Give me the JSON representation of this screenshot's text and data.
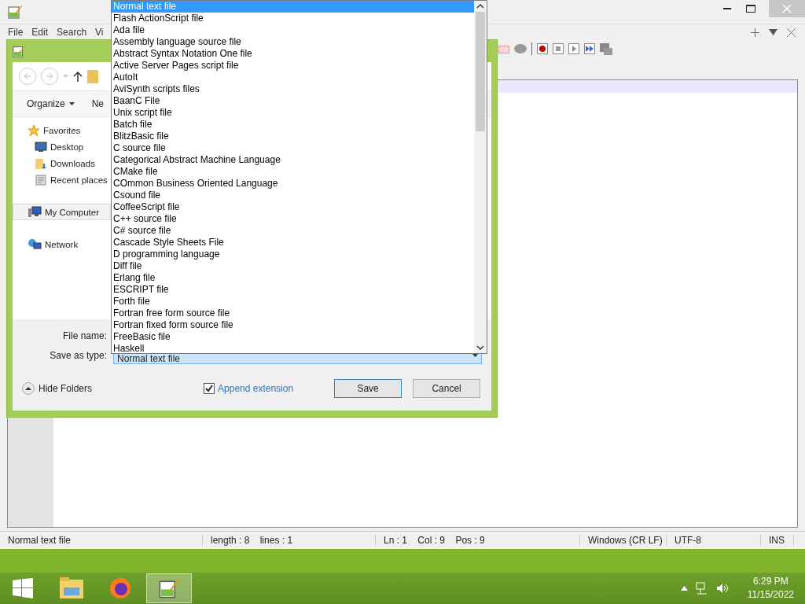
{
  "app_window": {
    "menu": [
      "File",
      "Edit",
      "Search",
      "Vi"
    ]
  },
  "status_bar": [
    "Normal text file",
    "length : 8    lines : 1",
    "Ln : 1    Col : 9    Pos : 9",
    "Windows (CR LF)",
    "UTF-8",
    "INS"
  ],
  "dialog": {
    "toolbar": [
      "Organize",
      "Ne"
    ],
    "sidebar": [
      {
        "label": "Favorites",
        "kind": "star",
        "selected": false,
        "children": [
          {
            "label": "Desktop",
            "kind": "desktop",
            "selected": false
          },
          {
            "label": "Downloads",
            "kind": "downloads",
            "selected": false
          },
          {
            "label": "Recent places",
            "kind": "recent",
            "selected": false
          }
        ]
      },
      {
        "label": "My Computer",
        "kind": "computer",
        "selected": true
      },
      {
        "label": "Network",
        "kind": "network",
        "selected": false
      }
    ],
    "file_name_label": "File name:",
    "save_type_label": "Save as type:",
    "save_type_value": "Normal text file",
    "hide_folders": "Hide Folders",
    "append_extension": {
      "label": "Append extension",
      "checked": true
    },
    "buttons": [
      "Save",
      "Cancel"
    ]
  },
  "type_list": [
    {
      "label": "Normal text file",
      "selected": true
    },
    {
      "label": "Flash ActionScript file",
      "selected": false
    },
    {
      "label": "Ada file",
      "selected": false
    },
    {
      "label": "Assembly language source file",
      "selected": false
    },
    {
      "label": "Abstract Syntax Notation One file",
      "selected": false
    },
    {
      "label": "Active Server Pages script file",
      "selected": false
    },
    {
      "label": "AutoIt",
      "selected": false
    },
    {
      "label": "AviSynth scripts files",
      "selected": false
    },
    {
      "label": "BaanC File",
      "selected": false
    },
    {
      "label": "Unix script file",
      "selected": false
    },
    {
      "label": "Batch file",
      "selected": false
    },
    {
      "label": "BlitzBasic file",
      "selected": false
    },
    {
      "label": "C source file",
      "selected": false
    },
    {
      "label": "Categorical Abstract Machine Language",
      "selected": false
    },
    {
      "label": "CMake file",
      "selected": false
    },
    {
      "label": "COmmon Business Oriented Language",
      "selected": false
    },
    {
      "label": "Csound file",
      "selected": false
    },
    {
      "label": "CoffeeScript file",
      "selected": false
    },
    {
      "label": "C++ source file",
      "selected": false
    },
    {
      "label": "C# source file",
      "selected": false
    },
    {
      "label": "Cascade Style Sheets File",
      "selected": false
    },
    {
      "label": "D programming language",
      "selected": false
    },
    {
      "label": "Diff file",
      "selected": false
    },
    {
      "label": "Erlang file",
      "selected": false
    },
    {
      "label": "ESCRIPT file",
      "selected": false
    },
    {
      "label": "Forth file",
      "selected": false
    },
    {
      "label": "Fortran free form source file",
      "selected": false
    },
    {
      "label": "Fortran fixed form source file",
      "selected": false
    },
    {
      "label": "FreeBasic file",
      "selected": false
    },
    {
      "label": "Haskell",
      "selected": false
    }
  ],
  "taskbar": {
    "apps": [
      {
        "kind": "explorer",
        "selected": false
      },
      {
        "kind": "firefox",
        "selected": false
      },
      {
        "kind": "notepad",
        "selected": true
      }
    ],
    "time": "6:29 PM",
    "date": "11/15/2022"
  }
}
